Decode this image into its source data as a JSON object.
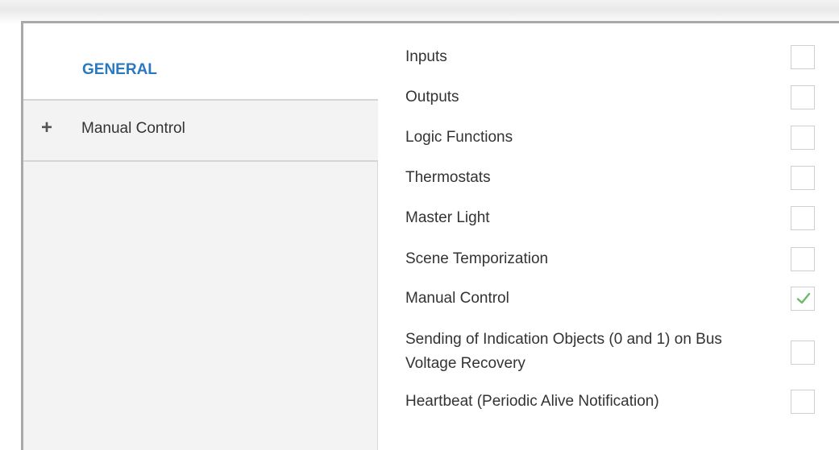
{
  "sidebar": {
    "items": [
      {
        "label": "GENERAL",
        "selected": true
      },
      {
        "label": "Manual Control",
        "expander": "+"
      }
    ]
  },
  "settings": {
    "rows": [
      {
        "label": "Inputs",
        "checked": false
      },
      {
        "label": "Outputs",
        "checked": false
      },
      {
        "label": "Logic Functions",
        "checked": false
      },
      {
        "label": "Thermostats",
        "checked": false
      },
      {
        "label": "Master Light",
        "checked": false
      },
      {
        "label": "Scene Temporization",
        "checked": false
      },
      {
        "label": "Manual Control",
        "checked": true
      },
      {
        "label": "Sending of Indication Objects (0 and 1) on Bus Voltage Recovery",
        "checked": false
      },
      {
        "label": "Heartbeat (Periodic Alive Notification)",
        "checked": false
      }
    ]
  },
  "colors": {
    "accent": "#2a79c0",
    "check": "#6bb96b",
    "sidebar_bg": "#f3f3f3"
  }
}
